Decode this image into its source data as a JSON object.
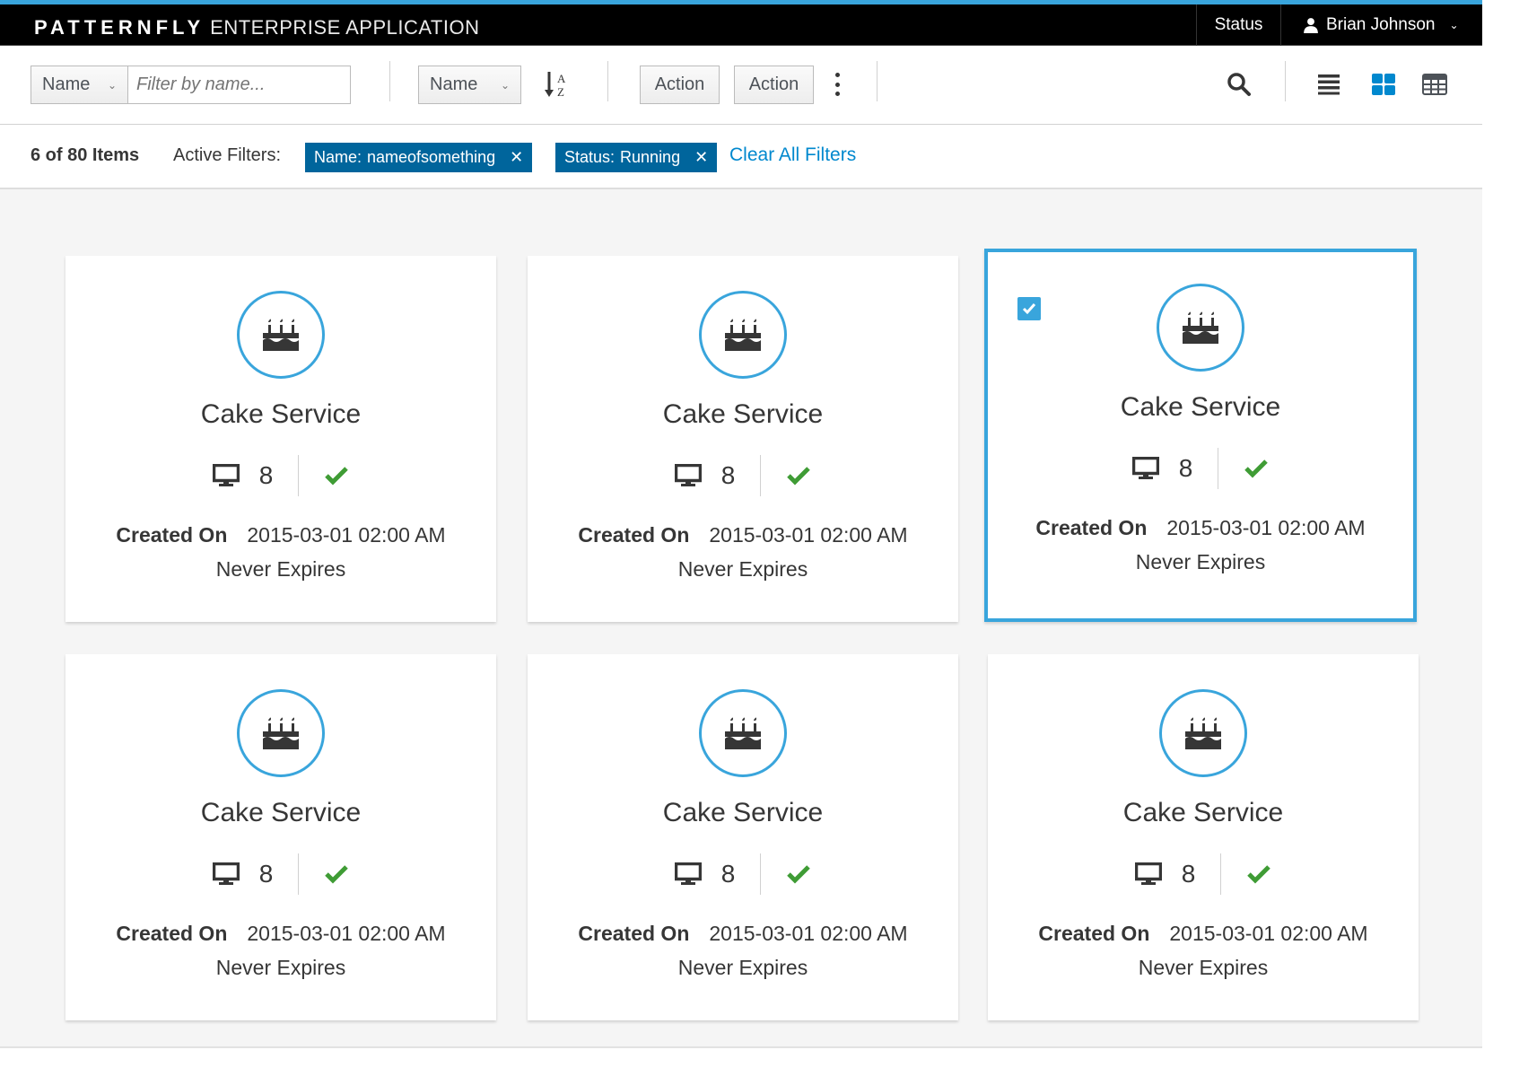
{
  "navbar": {
    "brand_bold": "PATTERNFLY",
    "brand_light": "ENTERPRISE APPLICATION",
    "status_label": "Status",
    "user_icon": "user-icon",
    "user_name": "Brian Johnson"
  },
  "toolbar": {
    "filter_field": "Name",
    "filter_placeholder": "Filter by name...",
    "sort_field": "Name",
    "sort_icon": "sort-alpha-asc-icon",
    "actions": [
      "Action",
      "Action"
    ],
    "kebab_icon": "kebab-icon",
    "search_icon": "search-icon",
    "view_icons": [
      {
        "name": "list-view-icon",
        "active": false
      },
      {
        "name": "card-view-icon",
        "active": true
      },
      {
        "name": "table-view-icon",
        "active": false
      }
    ]
  },
  "filters": {
    "count_text": "6 of 80 Items",
    "active_label": "Active Filters:",
    "chips": [
      {
        "field": "Name:",
        "value": "nameofsomething"
      },
      {
        "field": "Status:",
        "value": "Running"
      }
    ],
    "clear_all": "Clear All Filters"
  },
  "colors": {
    "accent": "#39a5dc",
    "chip": "#00659c",
    "link": "#0088ce",
    "success": "#3f9c35"
  },
  "cards": [
    {
      "title": "Cake Service",
      "icon": "birthday-cake-icon",
      "count": "8",
      "status_icon": "check-icon",
      "created_label": "Created On",
      "created_value": "2015-03-01 02:00 AM",
      "expires": "Never Expires",
      "selected": false
    },
    {
      "title": "Cake Service",
      "icon": "birthday-cake-icon",
      "count": "8",
      "status_icon": "check-icon",
      "created_label": "Created On",
      "created_value": "2015-03-01 02:00 AM",
      "expires": "Never Expires",
      "selected": false
    },
    {
      "title": "Cake Service",
      "icon": "birthday-cake-icon",
      "count": "8",
      "status_icon": "check-icon",
      "created_label": "Created On",
      "created_value": "2015-03-01 02:00 AM",
      "expires": "Never Expires",
      "selected": true
    },
    {
      "title": "Cake Service",
      "icon": "birthday-cake-icon",
      "count": "8",
      "status_icon": "check-icon",
      "created_label": "Created On",
      "created_value": "2015-03-01 02:00 AM",
      "expires": "Never Expires",
      "selected": false
    },
    {
      "title": "Cake Service",
      "icon": "birthday-cake-icon",
      "count": "8",
      "status_icon": "check-icon",
      "created_label": "Created On",
      "created_value": "2015-03-01 02:00 AM",
      "expires": "Never Expires",
      "selected": false
    },
    {
      "title": "Cake Service",
      "icon": "birthday-cake-icon",
      "count": "8",
      "status_icon": "check-icon",
      "created_label": "Created On",
      "created_value": "2015-03-01 02:00 AM",
      "expires": "Never Expires",
      "selected": false
    }
  ]
}
